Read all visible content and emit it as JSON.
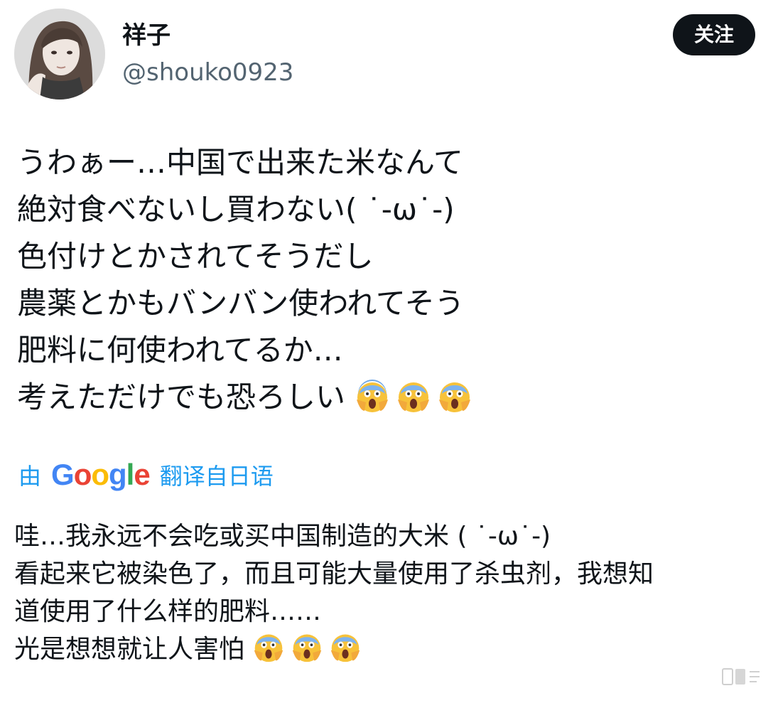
{
  "author": {
    "display_name": "祥子",
    "handle": "@shouko0923",
    "avatar_icon": "avatar-portrait"
  },
  "follow_button": {
    "label": "关注",
    "bg_color": "#0f1419",
    "text_color": "#ffffff"
  },
  "tweet": {
    "lines": [
      "うわぁー…中国で出来た米なんて",
      "絶対食べないし買わない( ˙-ω˙-)",
      "色付けとかされてそうだし",
      "農薬とかもバンバン使われてそう",
      "肥料に何使われてるか…",
      "考えただけでも恐ろしい"
    ],
    "trailing_emoji": [
      "face-screaming-in-fear-icon",
      "face-screaming-in-fear-icon",
      "face-screaming-in-fear-icon"
    ]
  },
  "translation": {
    "prefix": "由",
    "provider": "Google",
    "suffix": "翻译自日语",
    "link_color": "#1d9bf0",
    "lines": [
      "哇…我永远不会吃或买中国制造的大米 ( ˙-ω˙-)",
      "看起来它被染色了，而且可能大量使用了杀虫剂，我想知",
      "道使用了什么样的肥料……",
      "光是想想就让人害怕"
    ],
    "trailing_emoji": [
      "face-screaming-in-fear-icon",
      "face-screaming-in-fear-icon",
      "face-screaming-in-fear-icon"
    ]
  }
}
